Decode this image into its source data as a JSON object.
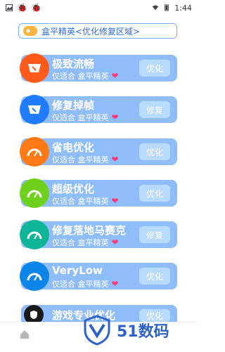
{
  "status_bar": {
    "time": "1:44",
    "left_icons": [
      "image-icon",
      "bug-icon",
      "bug-icon"
    ],
    "right_icons": [
      "wifi-icon",
      "battery-icon"
    ]
  },
  "header": {
    "label": "盒平精英<优化修复区域>",
    "icon": "gamepad-icon"
  },
  "cards": [
    {
      "title": "极致流畅",
      "sub": "仅适合 盒平精英",
      "button": "优化",
      "icon": "speedometer-icon",
      "badge_color": "#ff5a1a"
    },
    {
      "title": "修复掉帧",
      "sub": "仅适合 盒平精英",
      "button": "修复",
      "icon": "gauge-icon",
      "badge_color": "#1f7bff"
    },
    {
      "title": "省电优化",
      "sub": "仅适合 盒平精英",
      "button": "优化",
      "icon": "battery-gauge-icon",
      "badge_color": "#ff7a14"
    },
    {
      "title": "超级优化",
      "sub": "仅适合 盒平精英",
      "button": "优化",
      "icon": "speed-gauge-icon",
      "badge_color": "#6fd11e"
    },
    {
      "title": "修复落地马赛克",
      "sub": "仅适合 盒平精英",
      "button": "修复",
      "icon": "fix-gauge-icon",
      "badge_color": "#0fb598"
    },
    {
      "title": "VeryLow",
      "sub": "仅适合 盒平精英",
      "button": "优化",
      "icon": "low-gauge-icon",
      "badge_color": "#0c86e8"
    },
    {
      "title": "游戏专业优化",
      "sub": "",
      "button": "优化",
      "icon": "shield-icon",
      "badge_color": "#1a1a1a"
    }
  ],
  "bottom_bar": {
    "home_icon": "home-icon"
  },
  "watermark": {
    "text": "51数码"
  }
}
